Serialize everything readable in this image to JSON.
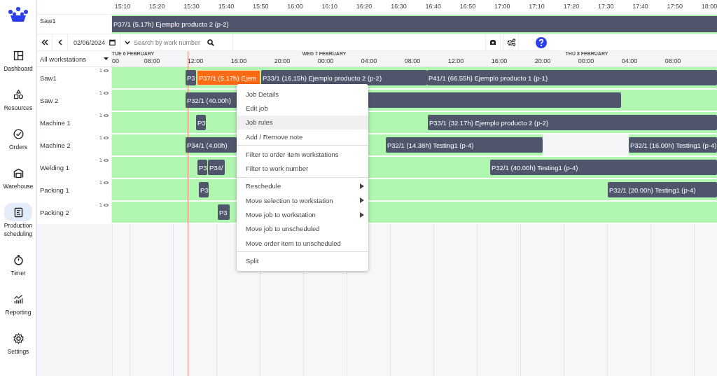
{
  "sidebar": {
    "items": [
      {
        "label": "Dashboard",
        "selected": false
      },
      {
        "label": "Resources",
        "selected": false
      },
      {
        "label": "Orders",
        "selected": false
      },
      {
        "label": "Warehouse",
        "selected": false
      },
      {
        "label": "Production scheduling",
        "selected": true
      },
      {
        "label": "Timer",
        "selected": false
      },
      {
        "label": "Reporting",
        "selected": false
      },
      {
        "label": "Settings",
        "selected": false
      }
    ]
  },
  "overview": {
    "time_ticks": [
      "15:10",
      "15:20",
      "15:30",
      "15:40",
      "15:50",
      "16:00",
      "16:10",
      "16:20",
      "16:30",
      "16:40",
      "16:50",
      "17:00",
      "17:10",
      "17:20",
      "17:30",
      "17:40",
      "17:50",
      "18:00"
    ],
    "workstation": "Saw1",
    "bar": {
      "label": "P37/1 (5.17h) Ejemplo producto 2 (p-2)"
    }
  },
  "toolbar": {
    "date": "02/06/2024",
    "search": {
      "placeholder": "Search by work number"
    }
  },
  "timeline": {
    "filter": "All workstations",
    "days": [
      "TUE 6 FEBRUARY",
      "WED 7 FEBRUARY",
      "THU 8 FEBRUARY"
    ],
    "hours": [
      "00",
      "08:00",
      "12:00",
      "16:00",
      "20:00",
      "00:00",
      "04:00",
      "08:00",
      "12:00",
      "16:00",
      "20:00",
      "00:00",
      "04:00",
      "08:00"
    ]
  },
  "rows": [
    {
      "name": "Saw1",
      "count": "1",
      "bars": [
        {
          "label": "P3",
          "selected": false
        },
        {
          "label": "P37/1 (5.17h) Ejem",
          "selected": true
        },
        {
          "label": "P33/1 (16.15h) Ejemplo producto 2 (p-2)",
          "selected": false
        },
        {
          "label": "P41/1 (66.55h) Ejemplo producto 1 (p-1)",
          "selected": false
        }
      ]
    },
    {
      "name": "Saw 2",
      "count": "1",
      "bars": [
        {
          "label": "P32/1 (40.00h)",
          "selected": false
        }
      ]
    },
    {
      "name": "Machine 1",
      "count": "1",
      "bars": [
        {
          "label": "P3",
          "selected": false
        },
        {
          "label": "P33/1 (32.17h) Ejemplo producto 2 (p-2)",
          "selected": false
        }
      ]
    },
    {
      "name": "Machine 2",
      "count": "1",
      "bars": [
        {
          "label": "P34/1 (4.00h)",
          "selected": false
        },
        {
          "label": "P32/1 (14.38h) Testing1 (p-4)",
          "selected": false
        },
        {
          "label": "P32/1 (16.00h) Testing1 (p-4)",
          "selected": false
        }
      ]
    },
    {
      "name": "Welding 1",
      "count": "1",
      "bars": [
        {
          "label": "P3",
          "selected": false
        },
        {
          "label": "P34/",
          "selected": false
        },
        {
          "label": "P32/1 (40.00h) Testing1 (p-4)",
          "selected": false
        }
      ]
    },
    {
      "name": "Packing 1",
      "count": "1",
      "bars": [
        {
          "label": "P3",
          "selected": false
        },
        {
          "label": "P32/1 (20.00h) Testing1 (p-4)",
          "selected": false
        }
      ]
    },
    {
      "name": "Packing 2",
      "count": "1",
      "bars": [
        {
          "label": "P3",
          "selected": false
        }
      ]
    }
  ],
  "context_menu": {
    "sections": [
      [
        {
          "label": "Job Details",
          "has_submenu": false,
          "highlighted": false
        },
        {
          "label": "Edit job",
          "has_submenu": false,
          "highlighted": false
        },
        {
          "label": "Job rules",
          "has_submenu": false,
          "highlighted": true
        },
        {
          "label": "Add / Remove note",
          "has_submenu": false,
          "highlighted": false
        }
      ],
      [
        {
          "label": "Filter to order item workstations",
          "has_submenu": false,
          "highlighted": false
        },
        {
          "label": "Filter to work number",
          "has_submenu": false,
          "highlighted": false
        }
      ],
      [
        {
          "label": "Reschedule",
          "has_submenu": true,
          "highlighted": false
        },
        {
          "label": "Move selection to workstation",
          "has_submenu": true,
          "highlighted": false
        },
        {
          "label": "Move job to workstation",
          "has_submenu": true,
          "highlighted": false
        },
        {
          "label": "Move job to unscheduled",
          "has_submenu": false,
          "highlighted": false
        },
        {
          "label": "Move order item to unscheduled",
          "has_submenu": false,
          "highlighted": false
        }
      ],
      [
        {
          "label": "Split",
          "has_submenu": false,
          "highlighted": false
        }
      ]
    ]
  }
}
